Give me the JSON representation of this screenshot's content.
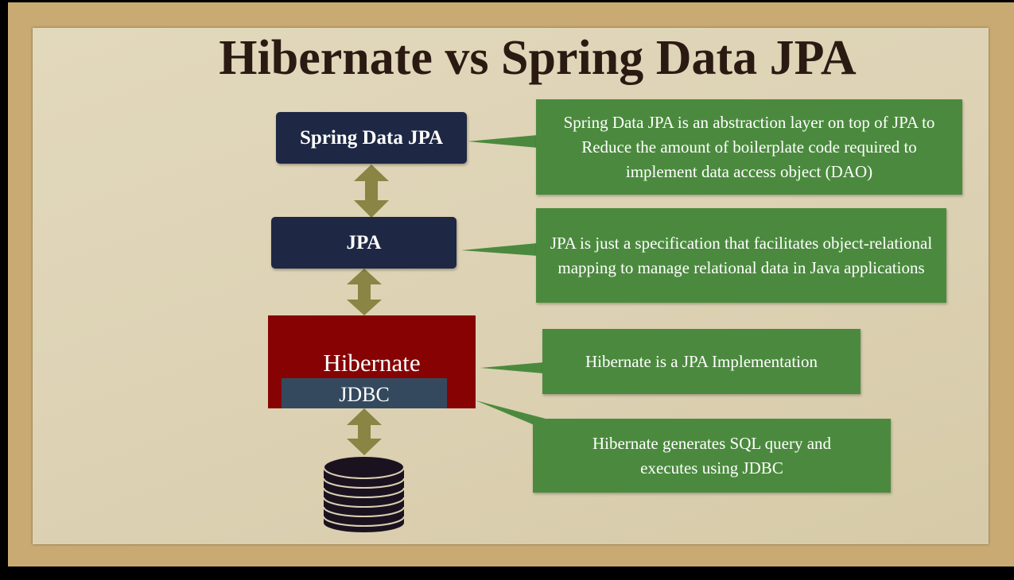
{
  "title": "Hibernate vs Spring Data JPA",
  "layers": {
    "spring_data_jpa": "Spring Data JPA",
    "jpa": "JPA",
    "hibernate": "Hibernate",
    "jdbc": "JDBC"
  },
  "callouts": [
    "Spring Data JPA is an abstraction layer on top of JPA to Reduce the amount of boilerplate code required to implement data access object (DAO)",
    "JPA is just a specification that facilitates object-relational mapping to manage relational data in Java applications",
    "Hibernate is a JPA Implementation",
    "Hibernate generates SQL query and executes using JDBC"
  ],
  "colors": {
    "navy": "#1e2844",
    "red": "#870303",
    "green": "#4b8a3e",
    "arrow": "#8a8445"
  }
}
